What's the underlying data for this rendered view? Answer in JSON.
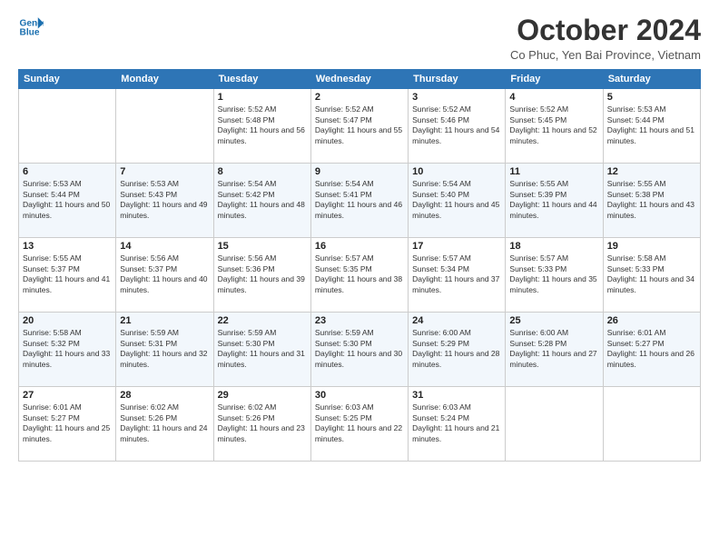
{
  "logo": {
    "line1": "General",
    "line2": "Blue"
  },
  "title": "October 2024",
  "location": "Co Phuc, Yen Bai Province, Vietnam",
  "header": {
    "days": [
      "Sunday",
      "Monday",
      "Tuesday",
      "Wednesday",
      "Thursday",
      "Friday",
      "Saturday"
    ]
  },
  "weeks": [
    [
      {
        "day": "",
        "sunrise": "",
        "sunset": "",
        "daylight": ""
      },
      {
        "day": "",
        "sunrise": "",
        "sunset": "",
        "daylight": ""
      },
      {
        "day": "1",
        "sunrise": "Sunrise: 5:52 AM",
        "sunset": "Sunset: 5:48 PM",
        "daylight": "Daylight: 11 hours and 56 minutes."
      },
      {
        "day": "2",
        "sunrise": "Sunrise: 5:52 AM",
        "sunset": "Sunset: 5:47 PM",
        "daylight": "Daylight: 11 hours and 55 minutes."
      },
      {
        "day": "3",
        "sunrise": "Sunrise: 5:52 AM",
        "sunset": "Sunset: 5:46 PM",
        "daylight": "Daylight: 11 hours and 54 minutes."
      },
      {
        "day": "4",
        "sunrise": "Sunrise: 5:52 AM",
        "sunset": "Sunset: 5:45 PM",
        "daylight": "Daylight: 11 hours and 52 minutes."
      },
      {
        "day": "5",
        "sunrise": "Sunrise: 5:53 AM",
        "sunset": "Sunset: 5:44 PM",
        "daylight": "Daylight: 11 hours and 51 minutes."
      }
    ],
    [
      {
        "day": "6",
        "sunrise": "Sunrise: 5:53 AM",
        "sunset": "Sunset: 5:44 PM",
        "daylight": "Daylight: 11 hours and 50 minutes."
      },
      {
        "day": "7",
        "sunrise": "Sunrise: 5:53 AM",
        "sunset": "Sunset: 5:43 PM",
        "daylight": "Daylight: 11 hours and 49 minutes."
      },
      {
        "day": "8",
        "sunrise": "Sunrise: 5:54 AM",
        "sunset": "Sunset: 5:42 PM",
        "daylight": "Daylight: 11 hours and 48 minutes."
      },
      {
        "day": "9",
        "sunrise": "Sunrise: 5:54 AM",
        "sunset": "Sunset: 5:41 PM",
        "daylight": "Daylight: 11 hours and 46 minutes."
      },
      {
        "day": "10",
        "sunrise": "Sunrise: 5:54 AM",
        "sunset": "Sunset: 5:40 PM",
        "daylight": "Daylight: 11 hours and 45 minutes."
      },
      {
        "day": "11",
        "sunrise": "Sunrise: 5:55 AM",
        "sunset": "Sunset: 5:39 PM",
        "daylight": "Daylight: 11 hours and 44 minutes."
      },
      {
        "day": "12",
        "sunrise": "Sunrise: 5:55 AM",
        "sunset": "Sunset: 5:38 PM",
        "daylight": "Daylight: 11 hours and 43 minutes."
      }
    ],
    [
      {
        "day": "13",
        "sunrise": "Sunrise: 5:55 AM",
        "sunset": "Sunset: 5:37 PM",
        "daylight": "Daylight: 11 hours and 41 minutes."
      },
      {
        "day": "14",
        "sunrise": "Sunrise: 5:56 AM",
        "sunset": "Sunset: 5:37 PM",
        "daylight": "Daylight: 11 hours and 40 minutes."
      },
      {
        "day": "15",
        "sunrise": "Sunrise: 5:56 AM",
        "sunset": "Sunset: 5:36 PM",
        "daylight": "Daylight: 11 hours and 39 minutes."
      },
      {
        "day": "16",
        "sunrise": "Sunrise: 5:57 AM",
        "sunset": "Sunset: 5:35 PM",
        "daylight": "Daylight: 11 hours and 38 minutes."
      },
      {
        "day": "17",
        "sunrise": "Sunrise: 5:57 AM",
        "sunset": "Sunset: 5:34 PM",
        "daylight": "Daylight: 11 hours and 37 minutes."
      },
      {
        "day": "18",
        "sunrise": "Sunrise: 5:57 AM",
        "sunset": "Sunset: 5:33 PM",
        "daylight": "Daylight: 11 hours and 35 minutes."
      },
      {
        "day": "19",
        "sunrise": "Sunrise: 5:58 AM",
        "sunset": "Sunset: 5:33 PM",
        "daylight": "Daylight: 11 hours and 34 minutes."
      }
    ],
    [
      {
        "day": "20",
        "sunrise": "Sunrise: 5:58 AM",
        "sunset": "Sunset: 5:32 PM",
        "daylight": "Daylight: 11 hours and 33 minutes."
      },
      {
        "day": "21",
        "sunrise": "Sunrise: 5:59 AM",
        "sunset": "Sunset: 5:31 PM",
        "daylight": "Daylight: 11 hours and 32 minutes."
      },
      {
        "day": "22",
        "sunrise": "Sunrise: 5:59 AM",
        "sunset": "Sunset: 5:30 PM",
        "daylight": "Daylight: 11 hours and 31 minutes."
      },
      {
        "day": "23",
        "sunrise": "Sunrise: 5:59 AM",
        "sunset": "Sunset: 5:30 PM",
        "daylight": "Daylight: 11 hours and 30 minutes."
      },
      {
        "day": "24",
        "sunrise": "Sunrise: 6:00 AM",
        "sunset": "Sunset: 5:29 PM",
        "daylight": "Daylight: 11 hours and 28 minutes."
      },
      {
        "day": "25",
        "sunrise": "Sunrise: 6:00 AM",
        "sunset": "Sunset: 5:28 PM",
        "daylight": "Daylight: 11 hours and 27 minutes."
      },
      {
        "day": "26",
        "sunrise": "Sunrise: 6:01 AM",
        "sunset": "Sunset: 5:27 PM",
        "daylight": "Daylight: 11 hours and 26 minutes."
      }
    ],
    [
      {
        "day": "27",
        "sunrise": "Sunrise: 6:01 AM",
        "sunset": "Sunset: 5:27 PM",
        "daylight": "Daylight: 11 hours and 25 minutes."
      },
      {
        "day": "28",
        "sunrise": "Sunrise: 6:02 AM",
        "sunset": "Sunset: 5:26 PM",
        "daylight": "Daylight: 11 hours and 24 minutes."
      },
      {
        "day": "29",
        "sunrise": "Sunrise: 6:02 AM",
        "sunset": "Sunset: 5:26 PM",
        "daylight": "Daylight: 11 hours and 23 minutes."
      },
      {
        "day": "30",
        "sunrise": "Sunrise: 6:03 AM",
        "sunset": "Sunset: 5:25 PM",
        "daylight": "Daylight: 11 hours and 22 minutes."
      },
      {
        "day": "31",
        "sunrise": "Sunrise: 6:03 AM",
        "sunset": "Sunset: 5:24 PM",
        "daylight": "Daylight: 11 hours and 21 minutes."
      },
      {
        "day": "",
        "sunrise": "",
        "sunset": "",
        "daylight": ""
      },
      {
        "day": "",
        "sunrise": "",
        "sunset": "",
        "daylight": ""
      }
    ]
  ]
}
